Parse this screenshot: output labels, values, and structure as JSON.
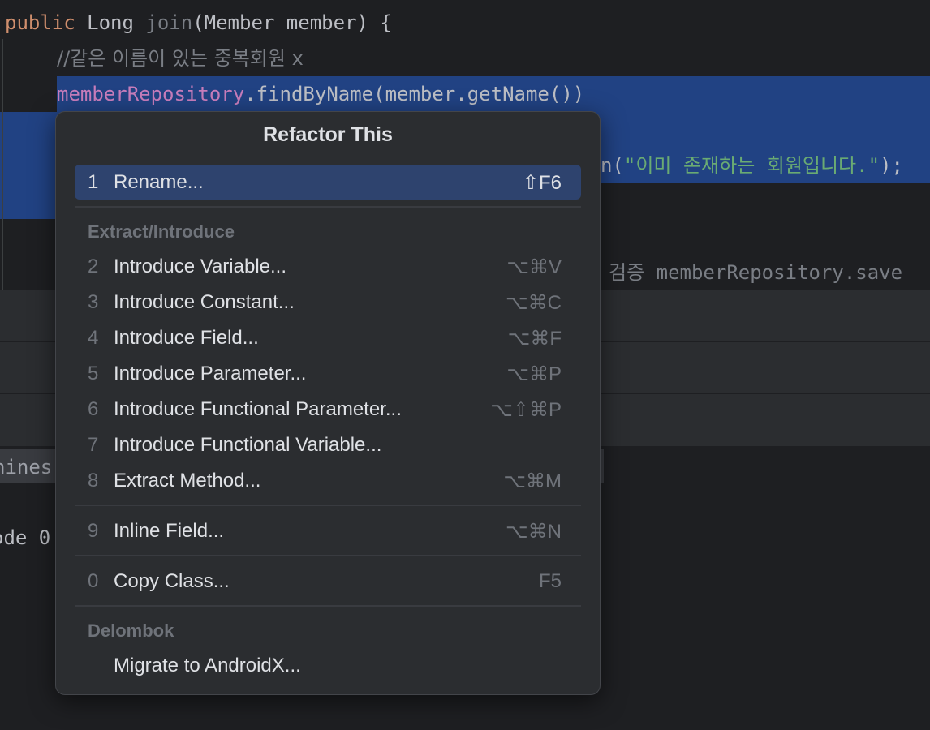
{
  "editor": {
    "line1": {
      "kw": "public",
      "type": "Long",
      "method": "join",
      "params": "(Member member) {"
    },
    "line2": {
      "comment": "//같은 이름이 있는 중복회원 x"
    },
    "line3": {
      "field": "memberRepository",
      "rest": ".findByName(member.getName())"
    },
    "line4": {
      "prefix": "n(",
      "string": "\"이미 존재하는 회원입니다.\"",
      "suffix": ");"
    },
    "line5": {
      "comment": "검증",
      "rest": "memberRepository.save"
    },
    "bottom_tab_fragment": "hines",
    "console_fragment": "ode 0"
  },
  "popup": {
    "title": "Refactor This",
    "items": [
      {
        "num": "1",
        "label": "Rename...",
        "shortcut": "⇧F6"
      },
      {
        "num": "2",
        "label": "Introduce Variable...",
        "shortcut": "⌥⌘V"
      },
      {
        "num": "3",
        "label": "Introduce Constant...",
        "shortcut": "⌥⌘C"
      },
      {
        "num": "4",
        "label": "Introduce Field...",
        "shortcut": "⌥⌘F"
      },
      {
        "num": "5",
        "label": "Introduce Parameter...",
        "shortcut": "⌥⌘P"
      },
      {
        "num": "6",
        "label": "Introduce Functional Parameter...",
        "shortcut": "⌥⇧⌘P"
      },
      {
        "num": "7",
        "label": "Introduce Functional Variable...",
        "shortcut": ""
      },
      {
        "num": "8",
        "label": "Extract Method...",
        "shortcut": "⌥⌘M"
      },
      {
        "num": "9",
        "label": "Inline Field...",
        "shortcut": "⌥⌘N"
      },
      {
        "num": "0",
        "label": "Copy Class...",
        "shortcut": "F5"
      },
      {
        "num": "",
        "label": "Migrate to AndroidX...",
        "shortcut": ""
      }
    ],
    "groups": {
      "extract": "Extract/Introduce",
      "delombok": "Delombok"
    }
  },
  "colors": {
    "editor_bg": "#1e1f22",
    "selection": "#214283",
    "popup_bg": "#2b2d30",
    "selected_item": "#2e436e"
  }
}
